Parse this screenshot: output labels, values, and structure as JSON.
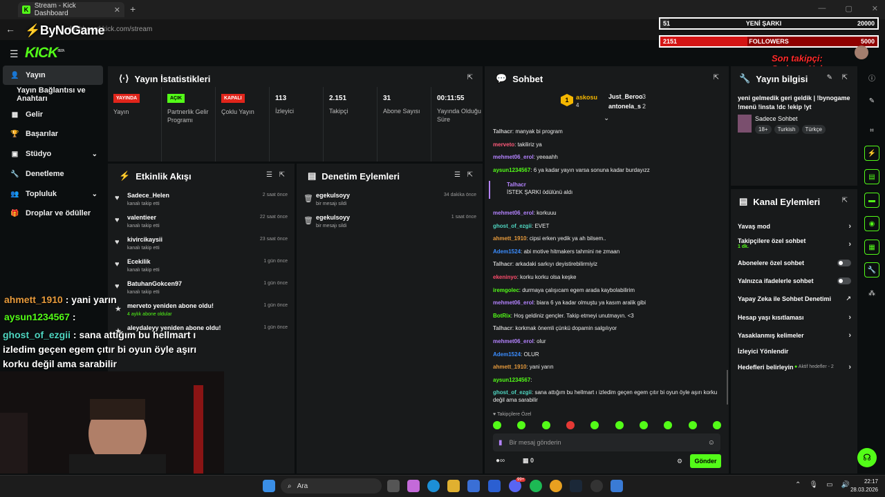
{
  "browser": {
    "tab_title": "Stream - Kick Dashboard",
    "tab_close": "✕",
    "new_tab": "+",
    "url": "dashboard.kick.com/stream",
    "win_controls": [
      "—",
      "▢",
      "✕"
    ]
  },
  "overlay": {
    "channel_logo": "ByNoGame",
    "song_bar": {
      "left": "51",
      "label": "YENİ ŞARKI",
      "right": "20000",
      "fraction": 0.04
    },
    "followers_bar": {
      "left": "2151",
      "label": "FOLLOWERS",
      "right": "5000",
      "fraction": 0.4
    },
    "last_follower": "Son takipçi: Sadece_Helen",
    "chat": [
      {
        "user": "ahmett_1910",
        "sep": " : ",
        "text": "yani yarın",
        "color": "#e89b3c"
      },
      {
        "user": "aysun1234567",
        "sep": " : ",
        "text": "",
        "color": "#53fc18"
      },
      {
        "user": "ghost_of_ezgii",
        "sep": " : ",
        "text": "sana attığım bu hellmart ı izledim geçen egem çıtır bi oyun öyle aşırı korku değil ama sarabilir",
        "color": "#4fd6c1"
      }
    ]
  },
  "header": {
    "logo": "KICK",
    "beta": "BETA"
  },
  "sidebar": {
    "items": [
      {
        "label": "Yayın",
        "icon": "user-icon"
      },
      {
        "label": "Yayın Bağlantısı ve Anahtarı",
        "icon": ""
      },
      {
        "label": "Gelir",
        "icon": "income-icon"
      },
      {
        "label": "Başarılar",
        "icon": "trophy-icon"
      },
      {
        "label": "Stüdyo",
        "icon": "studio-icon"
      },
      {
        "label": "Denetleme",
        "icon": "wrench-icon"
      },
      {
        "label": "Topluluk",
        "icon": "community-icon"
      },
      {
        "label": "Droplar ve ödüller",
        "icon": "gift-icon"
      }
    ]
  },
  "stats": {
    "title": "Yayın İstatistikleri",
    "items": [
      {
        "badge": "YAYINDA",
        "label": "Yayın"
      },
      {
        "badge": "AÇIK",
        "label": "Partnerlik Gelir Programı"
      },
      {
        "badge": "KAPALI",
        "label": "Çoklu Yayın"
      },
      {
        "value": "113",
        "label": "İzleyici"
      },
      {
        "value": "2.151",
        "label": "Takipçi"
      },
      {
        "value": "31",
        "label": "Abone Sayısı"
      },
      {
        "value": "00:11:55",
        "label": "Yayında Olduğu Süre"
      }
    ]
  },
  "activity": {
    "title": "Etkinlik Akışı",
    "items": [
      {
        "name": "Sadece_Helen",
        "sub": "kanalı takip etti",
        "time": "2 saat önce"
      },
      {
        "name": "valentieer",
        "sub": "kanalı takip etti",
        "time": "22 saat önce"
      },
      {
        "name": "kivircikaysii",
        "sub": "kanalı takip etti",
        "time": "23 saat önce"
      },
      {
        "name": "Ecekilik",
        "sub": "kanalı takip etti",
        "time": "1 gün önce"
      },
      {
        "name": "BatuhanGokcen97",
        "sub": "kanalı takip etti",
        "time": "1 gün önce"
      },
      {
        "name": "merveto yeniden abone oldu!",
        "sub": "4 aylık abone oldular",
        "time": "1 gün önce"
      },
      {
        "name": "aleydaleyy yeniden abone oldu!",
        "sub": "",
        "time": "1 gün önce"
      }
    ]
  },
  "moderation": {
    "title": "Denetim Eylemleri",
    "items": [
      {
        "name": "egekulsoyy",
        "sub": "bir mesajı sildi",
        "time": "34 dakika önce"
      },
      {
        "name": "egekulsoyy",
        "sub": "bir mesajı sildi",
        "time": "1 saat önce"
      }
    ]
  },
  "chat": {
    "title": "Sohbet",
    "leaders": [
      {
        "rank": "1",
        "name": "askosu",
        "count": "4"
      },
      {
        "name": "Just_Beroo",
        "count": "3"
      },
      {
        "name": "antonela_s",
        "count": "2"
      }
    ],
    "messages": [
      {
        "user": "Talhacr",
        "text": ": manyak bi program",
        "color": "#c9c9c9"
      },
      {
        "user": "merveto",
        "text": ": takiliriz ya",
        "color": "#ff5a7a"
      },
      {
        "user": "mehmet06_erol",
        "text": ": yeeaahh",
        "color": "#b483ff"
      },
      {
        "user": "aysun1234567",
        "text": ": 6 ya kadar yayın varsa sonuna kadar burdayızz",
        "color": "#53fc18"
      },
      {
        "user": "Talhacr",
        "text": "İSTEK ŞARKI ödülünü aldı",
        "color": "#b483ff"
      },
      {
        "user": "mehmet06_erol",
        "text": ": korkuuu",
        "color": "#b483ff"
      },
      {
        "user": "ghost_of_ezgii",
        "text": ": EVET",
        "color": "#4fd6c1"
      },
      {
        "user": "ahmett_1910",
        "text": ": cipsi erken yedik ya ah bilsem..",
        "color": "#e89b3c"
      },
      {
        "user": "Adem1524",
        "text": ": abi motive hitmakers tahmini ne zmaan",
        "color": "#3b8dff"
      },
      {
        "user": "Talhacr",
        "text": ": arkadaki sarkıyı deyistirebilirmiyiz",
        "color": "#c9c9c9"
      },
      {
        "user": "ekeninyo",
        "text": ": korku korku olsa keşke",
        "color": "#ff4d6d"
      },
      {
        "user": "iremgolec",
        "text": ": durmaya çalışıcam egem arada kaybolabilirim",
        "color": "#53fc18"
      },
      {
        "user": "mehmet06_erol",
        "text": ": biara 6 ya kadar olmuştu ya kasım aralik gibi",
        "color": "#b483ff"
      },
      {
        "user": "BotRix",
        "text": ": Hoş geldiniz gençler. Takip etmeyi unutmayın. <3",
        "color": "#53fc18"
      },
      {
        "user": "Talhacr",
        "text": ": korkmak önemli çünkü dopamin salgılıyor",
        "color": "#c9c9c9"
      },
      {
        "user": "mehmet06_erol",
        "text": ": olur",
        "color": "#b483ff"
      },
      {
        "user": "Adem1524",
        "text": ": OLUR",
        "color": "#3b8dff"
      },
      {
        "user": "ahmett_1910",
        "text": ": yani yarın",
        "color": "#e89b3c"
      },
      {
        "user": "aysun1234567",
        "text": ":",
        "color": "#53fc18"
      },
      {
        "user": "ghost_of_ezgii",
        "text": ": sana attığım bu hellmart ı izledim geçen egem çıtır bi oyun öyle aşırı korku değil ama sarabilir",
        "color": "#4fd6c1"
      }
    ],
    "followers_only": "Takipçilere Özel",
    "input_placeholder": "Bir mesaj gönderin",
    "infinite": "∞",
    "zero": "0",
    "send_label": "Gönder"
  },
  "stream_info": {
    "title": "Yayın bilgisi",
    "desc": "yeni gelmedik geri geldik | !bynogame !menü !insta !dc !ekip !yt",
    "category": "Sadece Sohbet",
    "tags": [
      "18+",
      "Turkish",
      "Türkçe"
    ]
  },
  "channel_actions": {
    "title": "Kanal Eylemleri",
    "items": [
      {
        "label": "Yavaş mod",
        "type": "arrow"
      },
      {
        "label": "Takipçilere özel sohbet",
        "sub": "1 dk.",
        "type": "arrow"
      },
      {
        "label": "Abonelere özel sohbet",
        "type": "toggle"
      },
      {
        "label": "Yalnızca ifadelerle sohbet",
        "type": "toggle"
      },
      {
        "label": "Yapay Zeka ile Sohbet Denetimi",
        "type": "ext"
      },
      {
        "label": "Hesap yaşı kısıtlaması",
        "type": "arrow"
      },
      {
        "label": "Yasaklanmış kelimeler",
        "type": "arrow"
      },
      {
        "label": "İzleyici Yönlendir",
        "type": "none"
      },
      {
        "label": "Hedefleri belirleyin",
        "extra": "Aktif hedefler - 2",
        "type": "arrow"
      }
    ]
  },
  "taskbar": {
    "search": "Ara",
    "time": "22:17",
    "date": "28.03.2026",
    "badge": "99+"
  }
}
